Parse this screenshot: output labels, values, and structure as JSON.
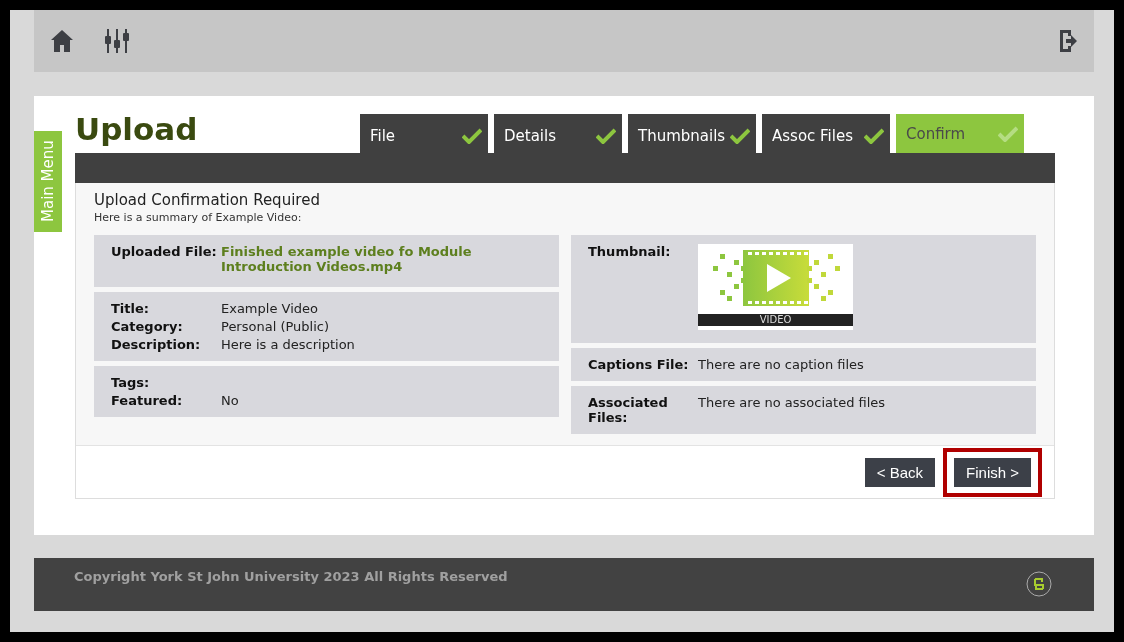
{
  "page_title": "Upload",
  "main_menu": "Main Menu",
  "tabs": [
    {
      "label": "File",
      "completed": true,
      "selected": false
    },
    {
      "label": "Details",
      "completed": true,
      "selected": false
    },
    {
      "label": "Thumbnails",
      "completed": true,
      "selected": false
    },
    {
      "label": "Assoc Files",
      "completed": true,
      "selected": false
    },
    {
      "label": "Confirm",
      "completed": true,
      "selected": true
    }
  ],
  "heading": "Upload Confirmation Required",
  "subheading": "Here is a summary of Example Video:",
  "left_groups": [
    [
      {
        "label": "Uploaded File:",
        "value": "Finished example video fo Module Introduction Videos.mp4",
        "kind": "file"
      }
    ],
    [
      {
        "label": "Title:",
        "value": "Example Video",
        "kind": "text"
      },
      {
        "label": "Category:",
        "value": "Personal (Public)",
        "kind": "text"
      },
      {
        "label": "Description:",
        "value": "Here is a description",
        "kind": "text"
      }
    ],
    [
      {
        "label": "Tags:",
        "kind": "text"
      },
      {
        "label": "Featured:",
        "value": "No",
        "kind": "text"
      }
    ]
  ],
  "thumbnail": {
    "label": "Thumbnail:",
    "caption": "VIDEO"
  },
  "right_rows": [
    {
      "label": "Captions File:",
      "value": "There are no caption files"
    },
    {
      "label": "Associated Files:",
      "value": "There are no associated files"
    }
  ],
  "buttons": [
    {
      "label": "< Back",
      "highlighted": false
    },
    {
      "label": "Finish >",
      "highlighted": true
    }
  ],
  "footer": "Copyright York St John University 2023 All Rights Reserved"
}
